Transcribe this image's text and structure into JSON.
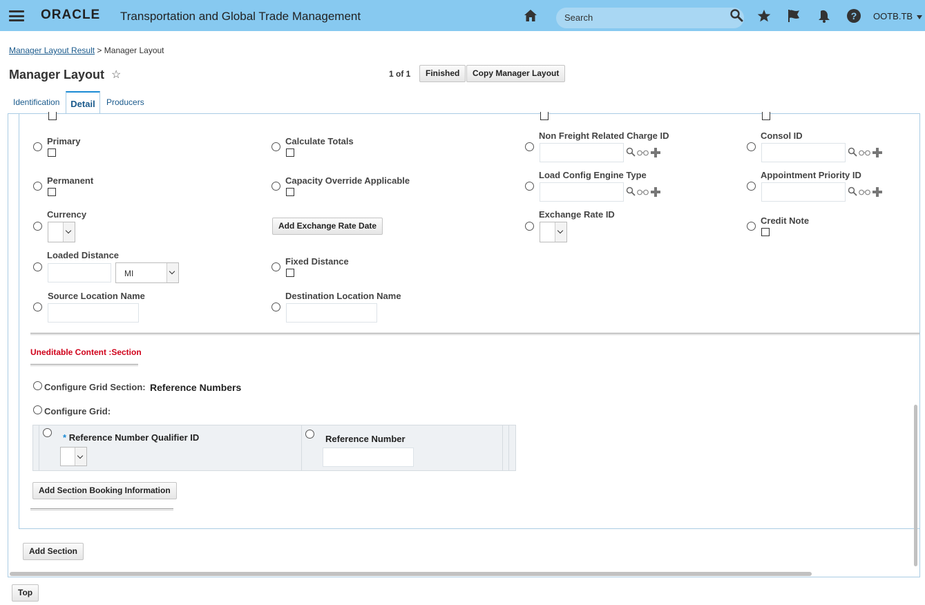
{
  "header": {
    "brand": "ORACLE",
    "app_title": "Transportation and Global Trade Management",
    "search_placeholder": "Search",
    "user": "OOTB.TB"
  },
  "breadcrumb": {
    "parent": "Manager Layout Result",
    "separator": ">",
    "current": "Manager Layout"
  },
  "page": {
    "title": "Manager Layout",
    "pager": "1 of 1",
    "finished_label": "Finished",
    "copy_label": "Copy Manager Layout"
  },
  "tabs": {
    "identification": "Identification",
    "detail": "Detail",
    "producers": "Producers"
  },
  "fields": {
    "primary": "Primary",
    "calculate_totals": "Calculate Totals",
    "non_freight_charge_id": "Non Freight Related Charge ID",
    "consol_id": "Consol ID",
    "permanent": "Permanent",
    "capacity_override": "Capacity Override Applicable",
    "load_config_engine": "Load Config Engine Type",
    "appointment_priority": "Appointment Priority ID",
    "currency": "Currency",
    "add_exchange_rate_date": "Add Exchange Rate Date",
    "exchange_rate_id": "Exchange Rate ID",
    "credit_note": "Credit Note",
    "loaded_distance": "Loaded Distance",
    "loaded_distance_unit": "MI",
    "fixed_distance": "Fixed Distance",
    "source_location_name": "Source Location Name",
    "destination_location_name": "Destination Location Name"
  },
  "section": {
    "uneditable": "Uneditable Content :Section",
    "configure_grid_section_label": "Configure Grid Section:",
    "configure_grid_section_value": "Reference Numbers",
    "configure_grid_label": "Configure Grid:",
    "grid_col1_required": "*",
    "grid_col1": "Reference Number Qualifier ID",
    "grid_col2": "Reference Number",
    "add_section_booking": "Add Section Booking Information"
  },
  "footer": {
    "add_section": "Add Section",
    "top": "Top"
  }
}
